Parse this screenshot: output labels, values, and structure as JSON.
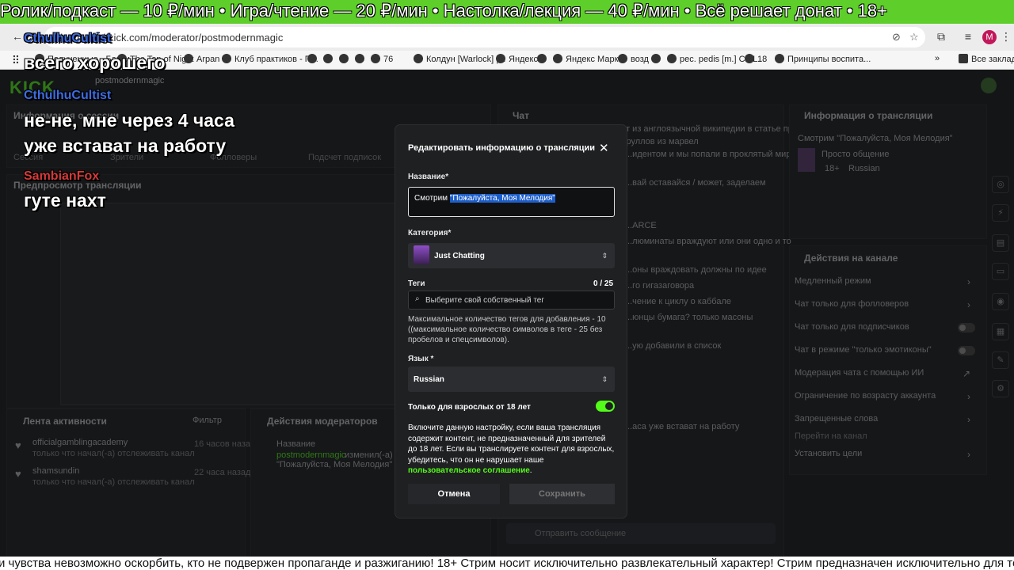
{
  "ticker_top": "Ролик/подкаст — 10 ₽/мин • Игра/чтение — 20 ₽/мин • Настолка/лекция — 40 ₽/мин • Всё решает донат • 18+",
  "ticker_bottom": "и чувства невозможно оскорбить, кто не подвержен пропаганде и разжиганию! 18+ Стрим носит исключительно развлекательный характер! Стрим предназначен исключительно для тех, ч",
  "browser": {
    "url": "dashboard.kick.com/moderator/postmodernmagic",
    "profile_initial": "M",
    "bookmarks": [
      "Полученные - Банки",
      "The Top of Night",
      "Arpan",
      "Клуб практиков - П...",
      "76",
      "Колдун [Warlock] |...",
      "Яндекс",
      "Яндекс Маркет",
      "возд",
      "рес. pedis [m.] С - L...",
      "18",
      "Принципы воспита..."
    ],
    "all_bookmarks": "Все закладки"
  },
  "dashboard": {
    "logo": "KICK",
    "channel": "postmodernmagic",
    "session_info": "Информация о сессии",
    "session_label": "Сессия",
    "viewers_label": "Зрители",
    "followers_label": "Фолловеры",
    "subs_label": "Подсчет подписок",
    "preview_label": "Предпросмотр трансляции",
    "chat_title": "Чат",
    "chat_lines": [
      "...сновательность зараза и вот из англоязычной википедии в статье про",
      "...у лишь-то кто вышло про скруллов из марвел",
      "...идентом и мы попали в проклятый мир",
      "...вай оставайся / может, заделаем",
      "...ARCE",
      "...люминаты враждуют или они одно и то",
      "...оны враждовать должны по идее",
      "...го гигазаговора",
      "...чение к циклу о каббале",
      "...юнцы бумага? только масоны",
      "...ую добавили в список",
      "...аса уже встават на работу"
    ],
    "chat_placeholder": "Отправить сообщение",
    "stream_info_title": "Информация о трансляции",
    "stream_title": "Смотрим \"Пожалуйста, Моя Мелодия\"",
    "stream_category": "Просто общение",
    "stream_badge": "18+",
    "stream_lang": "Russian",
    "actions_title": "Действия на канале",
    "actions": [
      {
        "label": "Медленный режим",
        "kind": "arrow"
      },
      {
        "label": "Чат только для фолловеров",
        "kind": "arrow"
      },
      {
        "label": "Чат только для подписчиков",
        "kind": "toggle"
      },
      {
        "label": "Чат в режиме \"только эмотиконы\"",
        "kind": "toggle"
      },
      {
        "label": "Модерация чата с помощью ИИ",
        "kind": "link"
      },
      {
        "label": "Ограничение по возрасту аккаунта",
        "kind": "arrow"
      },
      {
        "label": "Запрещенные слова",
        "kind": "arrow"
      },
      {
        "label": "Перейти на канал",
        "kind": "none"
      },
      {
        "label": "Установить цели",
        "kind": "arrow"
      }
    ],
    "activity_title": "Лента активности",
    "activity_filter": "Фильтр",
    "activity": [
      {
        "user": "officialgamblingacademy",
        "action": "только что начал(-а) отслеживать канал",
        "time": "16 часов назад"
      },
      {
        "user": "shamsundin",
        "action": "только что начал(-а) отслеживать канал",
        "time": "22 часа назад"
      }
    ],
    "mod_title": "Действия модераторов",
    "mod_item_title": "Название",
    "mod_item_user": "postmodernmagic",
    "mod_item_action": "изменил(-а) назван...",
    "mod_item_value": "\"Пожалуйста, Моя Мелодия\""
  },
  "overlay_chat": [
    {
      "user": "CthulhuCultist",
      "text": "всего хорошего"
    },
    {
      "user": "CthulhuCultist",
      "text": "не-не, мне через 4 часа\nуже встават на работу"
    },
    {
      "user": "SambianFox",
      "text": "гуте нахт"
    }
  ],
  "modal": {
    "title": "Редактировать информацию о трансляции",
    "name_label": "Название*",
    "name_prefix": "Смотрим ",
    "name_highlight": "\"Пожалуйста, Моя Мелодия\"",
    "category_label": "Категория*",
    "category_value": "Just Chatting",
    "tags_label": "Теги",
    "tags_count": "0 / 25",
    "tags_placeholder": "Выберите свой собственный тег",
    "tags_help": "Максимальное количество тегов для добавления - 10 ((максимальное количество символов в теге - 25 без пробелов и спецсимволов).",
    "language_label": "Язык *",
    "language_value": "Russian",
    "adult_label": "Только для взрослых от 18 лет",
    "adult_enabled": true,
    "adult_desc": "Включите данную настройку, если ваша трансляция содержит контент, не предназначенный для зрителей до 18 лет. Если вы транслируете контент для взрослых, убедитесь, что он не нарушает наше ",
    "adult_link": "пользовательское соглашение",
    "adult_dot": ".",
    "cancel": "Отмена",
    "save": "Сохранить"
  },
  "colors": {
    "accent": "#53fc18",
    "ticker_top_bg": "#5ecf2a",
    "highlight": "#1d5ec9"
  }
}
